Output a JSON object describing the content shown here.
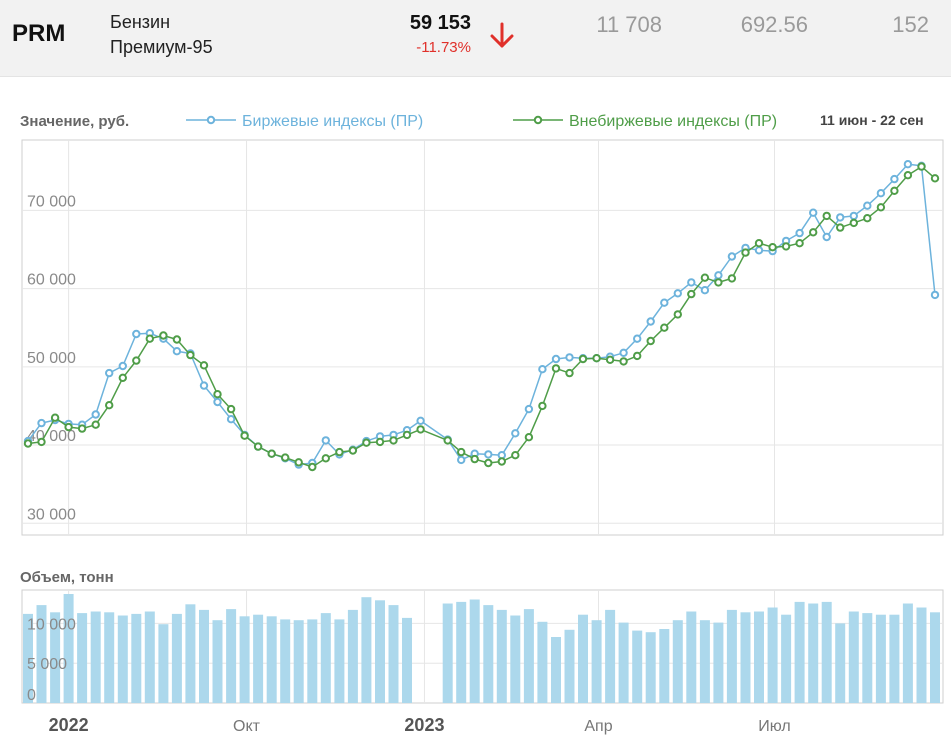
{
  "header": {
    "ticker": "PRM",
    "name_line1": "Бензин",
    "name_line2": "Премиум-95",
    "price": "59 153",
    "change": "-11.73%",
    "stat1": "11 708",
    "stat2": "692.56",
    "stat3": "152",
    "direction_icon": "arrow-down-icon"
  },
  "colors": {
    "exchange": "#6db3dc",
    "otc": "#4f9d48",
    "volume_bar": "#acd8ec",
    "down": "#e0302a",
    "grid": "#e6e6e6",
    "axis_text": "#8a8a8a"
  },
  "chart_data": [
    {
      "type": "line",
      "ylabel": "Значение, руб.",
      "date_range": "11 июн - 22 сен",
      "x": [
        "2022-06-10",
        "2022-06-17",
        "2022-06-24",
        "2022-07-01",
        "2022-07-08",
        "2022-07-15",
        "2022-07-22",
        "2022-07-29",
        "2022-08-05",
        "2022-08-12",
        "2022-08-19",
        "2022-08-26",
        "2022-09-02",
        "2022-09-09",
        "2022-09-16",
        "2022-09-23",
        "2022-09-30",
        "2022-10-07",
        "2022-10-14",
        "2022-10-21",
        "2022-10-28",
        "2022-11-04",
        "2022-11-11",
        "2022-11-18",
        "2022-11-25",
        "2022-12-02",
        "2022-12-09",
        "2022-12-16",
        "2022-12-23",
        "2022-12-30",
        "2023-01-13",
        "2023-01-20",
        "2023-01-27",
        "2023-02-03",
        "2023-02-10",
        "2023-02-17",
        "2023-02-24",
        "2023-03-03",
        "2023-03-10",
        "2023-03-17",
        "2023-03-24",
        "2023-03-31",
        "2023-04-07",
        "2023-04-14",
        "2023-04-21",
        "2023-04-28",
        "2023-05-05",
        "2023-05-12",
        "2023-05-19",
        "2023-05-26",
        "2023-06-02",
        "2023-06-09",
        "2023-06-16",
        "2023-06-23",
        "2023-06-30",
        "2023-07-07",
        "2023-07-14",
        "2023-07-21",
        "2023-07-28",
        "2023-08-04",
        "2023-08-11",
        "2023-08-18",
        "2023-08-25",
        "2023-09-01",
        "2023-09-08",
        "2023-09-15",
        "2023-09-22"
      ],
      "series": [
        {
          "name": "Биржевые индексы (ПР)",
          "values": [
            40500,
            42800,
            43200,
            42700,
            42600,
            43900,
            49200,
            50100,
            54200,
            54300,
            53600,
            52000,
            51700,
            47600,
            45500,
            43300,
            41300,
            39800,
            38900,
            38300,
            37500,
            37700,
            40600,
            38800,
            39400,
            40500,
            41100,
            41300,
            41900,
            43100,
            40700,
            38100,
            38900,
            38800,
            38700,
            41500,
            44600,
            49700,
            51000,
            51200,
            51100,
            51100,
            51300,
            51800,
            53600,
            55800,
            58200,
            59400,
            60800,
            59800,
            61700,
            64100,
            65200,
            64900,
            64800,
            66100,
            67100,
            69700,
            66600,
            69100,
            69300,
            70600,
            72200,
            74000,
            75900,
            75700,
            59200
          ]
        },
        {
          "name": "Внебиржевые индексы (ПР)",
          "values": [
            40200,
            40400,
            43500,
            42300,
            42100,
            42600,
            45100,
            48600,
            50800,
            53600,
            54000,
            53500,
            51500,
            50200,
            46500,
            44600,
            41200,
            39800,
            38900,
            38400,
            37800,
            37200,
            38300,
            39100,
            39300,
            40300,
            40400,
            40600,
            41300,
            42000,
            40600,
            39100,
            38200,
            37700,
            37900,
            38700,
            41000,
            45000,
            49800,
            49200,
            51000,
            51100,
            50900,
            50700,
            51400,
            53300,
            55000,
            56700,
            59300,
            61400,
            60800,
            61300,
            64600,
            65800,
            65300,
            65400,
            65800,
            67200,
            69300,
            67800,
            68400,
            69000,
            70400,
            72500,
            74500,
            75600,
            74100
          ]
        }
      ],
      "ylim": [
        28500,
        79000
      ],
      "yticks": [
        {
          "label": "30 000",
          "value": 30000
        },
        {
          "label": "40 000",
          "value": 40000
        },
        {
          "label": "50 000",
          "value": 50000
        },
        {
          "label": "60 000",
          "value": 60000
        },
        {
          "label": "70 000",
          "value": 70000
        }
      ],
      "grid": true,
      "legend": "top"
    },
    {
      "type": "bar",
      "ylabel": "Объем, тонн",
      "x": [
        "2022-06-10",
        "2022-06-17",
        "2022-06-24",
        "2022-07-01",
        "2022-07-08",
        "2022-07-15",
        "2022-07-22",
        "2022-07-29",
        "2022-08-05",
        "2022-08-12",
        "2022-08-19",
        "2022-08-26",
        "2022-09-02",
        "2022-09-09",
        "2022-09-16",
        "2022-09-23",
        "2022-09-30",
        "2022-10-07",
        "2022-10-14",
        "2022-10-21",
        "2022-10-28",
        "2022-11-04",
        "2022-11-11",
        "2022-11-18",
        "2022-11-25",
        "2022-12-02",
        "2022-12-09",
        "2022-12-16",
        "2022-12-23",
        "2022-12-30",
        "2023-01-13",
        "2023-01-20",
        "2023-01-27",
        "2023-02-03",
        "2023-02-10",
        "2023-02-17",
        "2023-02-24",
        "2023-03-03",
        "2023-03-10",
        "2023-03-17",
        "2023-03-24",
        "2023-03-31",
        "2023-04-07",
        "2023-04-14",
        "2023-04-21",
        "2023-04-28",
        "2023-05-05",
        "2023-05-12",
        "2023-05-19",
        "2023-05-26",
        "2023-06-02",
        "2023-06-09",
        "2023-06-16",
        "2023-06-23",
        "2023-06-30",
        "2023-07-07",
        "2023-07-14",
        "2023-07-21",
        "2023-07-28",
        "2023-08-04",
        "2023-08-11",
        "2023-08-18",
        "2023-08-25",
        "2023-09-01",
        "2023-09-08",
        "2023-09-15",
        "2023-09-22"
      ],
      "values": [
        11200,
        12300,
        11400,
        13700,
        11300,
        11500,
        11400,
        11000,
        11200,
        11500,
        9900,
        11200,
        12400,
        11700,
        10400,
        11800,
        10900,
        11100,
        10900,
        10500,
        10400,
        10500,
        11300,
        10500,
        11700,
        13300,
        12900,
        12300,
        10700,
        0,
        12500,
        12700,
        13000,
        12300,
        11700,
        11000,
        11800,
        10200,
        8300,
        9200,
        11100,
        10400,
        11700,
        10100,
        9100,
        8900,
        9300,
        10400,
        11500,
        10400,
        10100,
        11700,
        11400,
        11500,
        12000,
        11100,
        12700,
        12500,
        12700,
        10000,
        11500,
        11300,
        11100,
        11100,
        12500,
        12000,
        11400
      ],
      "ylim": [
        0,
        14200
      ],
      "yticks": [
        {
          "label": "0",
          "value": 0
        },
        {
          "label": "5 000",
          "value": 5000
        },
        {
          "label": "10 000",
          "value": 10000
        }
      ],
      "xticks": [
        {
          "label": "2022",
          "date": "2022-07-01",
          "bold": true
        },
        {
          "label": "Окт",
          "date": "2022-10-01",
          "bold": false
        },
        {
          "label": "2023",
          "date": "2023-01-01",
          "bold": true
        },
        {
          "label": "Апр",
          "date": "2023-04-01",
          "bold": false
        },
        {
          "label": "Июл",
          "date": "2023-07-01",
          "bold": false
        }
      ],
      "grid": true
    }
  ]
}
